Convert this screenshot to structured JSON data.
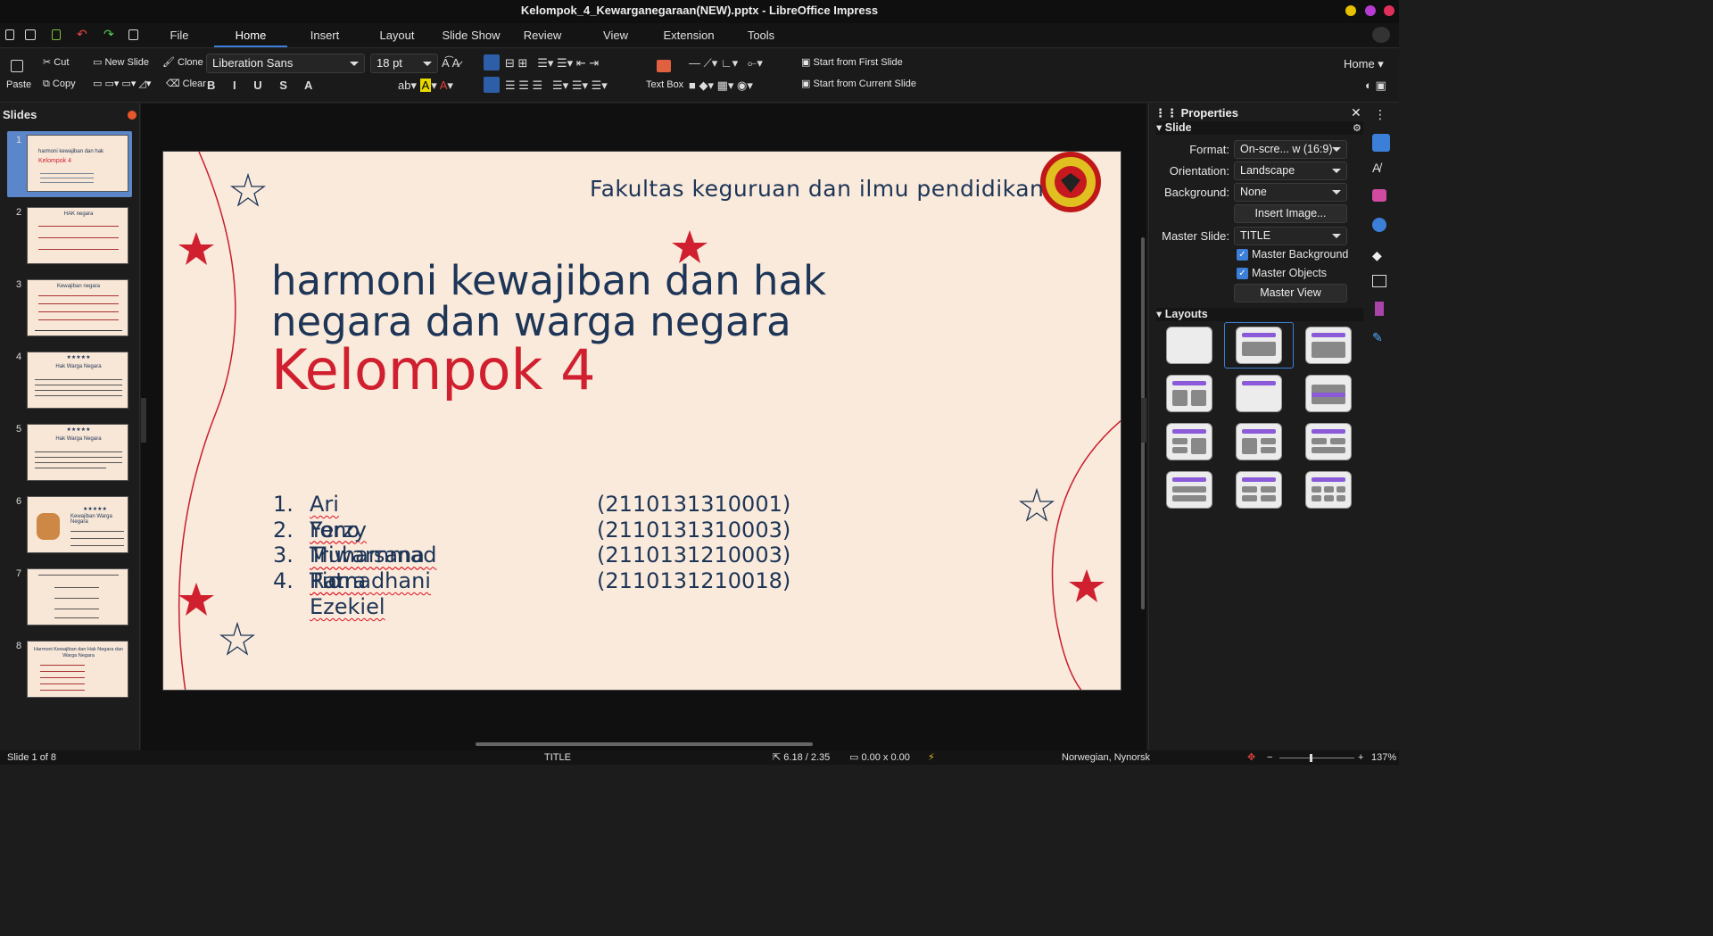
{
  "window": {
    "title": "Kelompok_4_Kewarganegaraan(NEW).pptx - LibreOffice Impress"
  },
  "menu": [
    "File",
    "Home",
    "Insert",
    "Layout",
    "Slide Show",
    "Review",
    "View",
    "Extension",
    "Tools"
  ],
  "menu_active": "Home",
  "toolbar": {
    "paste": "Paste",
    "cut": "Cut",
    "copy": "Copy",
    "new_slide": "New Slide",
    "clone": "Clone",
    "clear": "Clear",
    "font_name": "Liberation Sans",
    "font_size": "18 pt",
    "text_box": "Text Box",
    "start_first": "Start from First Slide",
    "start_current": "Start from Current Slide",
    "home_dropdown": "Home"
  },
  "slides_pane": {
    "title": "Slides",
    "numbers": [
      "1",
      "2",
      "3",
      "4",
      "5",
      "6",
      "7",
      "8"
    ]
  },
  "thumb_titles": {
    "t2": "HAK negara",
    "t3": "Kewajiban negara",
    "t4": "Hak Warga Negara",
    "t5": "Hak Warga Negara",
    "t6": "Kewajiban Warga Negara",
    "t8": "Harmoni Kewajiban dan Hak Negara dan Warga Negara"
  },
  "slide": {
    "header": "Fakultas keguruan dan ilmu pendidikan",
    "title_line1": "harmoni kewajiban dan hak",
    "title_line2": "negara dan warga negara",
    "subtitle": "Kelompok 4",
    "members": [
      {
        "num": "1.",
        "name": "Ari Yono",
        "id": "(2110131310001)"
      },
      {
        "num": "2.",
        "name": "Ferzy Triwarsana Putra",
        "id": "(2110131310003)"
      },
      {
        "num": "3.",
        "name": "Muhammad Ramadhani",
        "id": "(2110131210003)"
      },
      {
        "num": "4.",
        "name": "Tio Ezekiel",
        "id": "(2110131210018)"
      }
    ]
  },
  "properties": {
    "title": "Properties",
    "section_slide": "Slide",
    "format_label": "Format:",
    "format_value": "On-scre... w (16:9)",
    "orientation_label": "Orientation:",
    "orientation_value": "Landscape",
    "background_label": "Background:",
    "background_value": "None",
    "insert_image": "Insert Image...",
    "master_slide_label": "Master Slide:",
    "master_slide_value": "TITLE",
    "master_background": "Master Background",
    "master_objects": "Master Objects",
    "master_view": "Master View",
    "section_layouts": "Layouts"
  },
  "status": {
    "slide_pos": "Slide 1 of 8",
    "layout": "TITLE",
    "position": "6.18 / 2.35",
    "size": "0.00 x 0.00",
    "language": "Norwegian, Nynorsk",
    "zoom": "137%"
  },
  "colors": {
    "accent": "#3c7fd8",
    "slide_bg": "#faeadb",
    "navy": "#1d3557",
    "red": "#d0202f"
  }
}
